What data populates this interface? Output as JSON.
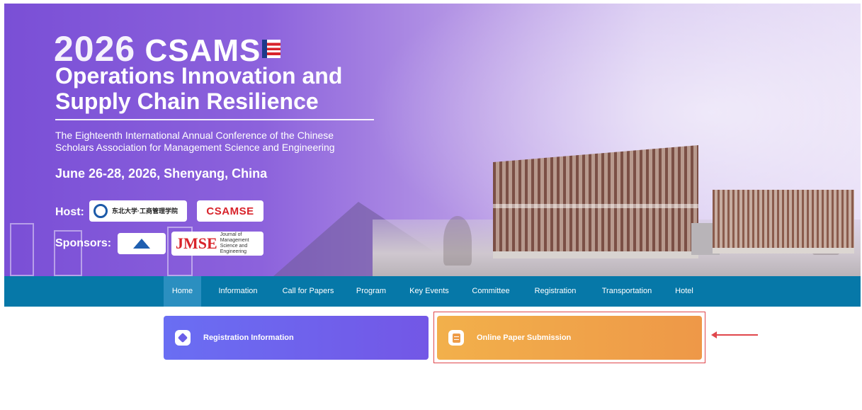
{
  "banner": {
    "year": "2026",
    "brand": "CSAMS",
    "title_line1": "Operations Innovation and",
    "title_line2": "Supply Chain Resilience",
    "subtitle": "The Eighteenth International Annual Conference of the Chinese Scholars Association for Management Science and Engineering",
    "date": "June 26-28, 2026, Shenyang, China",
    "host_label": "Host:",
    "sponsors_label": "Sponsors:",
    "host_logos": [
      "东北大学·工商管理学院",
      "CSAMSE"
    ],
    "sponsor_logos": [
      "National Natural Science Foundation of China",
      "JMSE"
    ],
    "jmse_text": "Journal of Management Science and Engineering"
  },
  "nav": {
    "items": [
      "Home",
      "Information",
      "Call for Papers",
      "Program",
      "Key Events",
      "Committee",
      "Registration",
      "Transportation",
      "Hotel"
    ],
    "active": "Home"
  },
  "cards": {
    "registration": "Registration Information",
    "submission": "Online Paper Submission"
  },
  "colors": {
    "nav_bg": "#0678a8",
    "nav_active": "#2b8fc0",
    "card_registration": "#6a6ef3",
    "card_submission": "#ee9848",
    "highlight": "#e0474c"
  },
  "icons": {
    "registration": "pen-icon",
    "submission": "document-icon",
    "annotation": "arrow-left-icon"
  }
}
